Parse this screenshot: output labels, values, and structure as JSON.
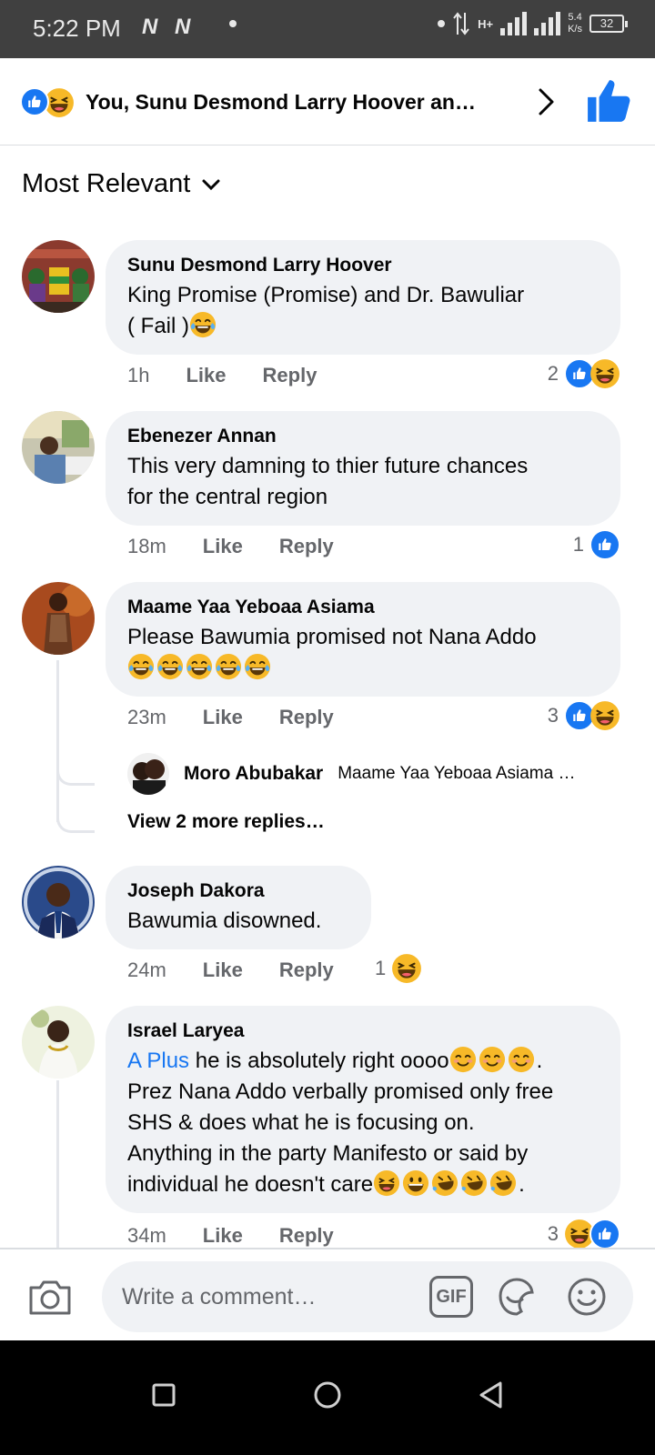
{
  "status_bar": {
    "time": "5:22 PM",
    "network_icons": "N N",
    "net_type": "H+",
    "speed_value": "5.4",
    "speed_unit": "K/s",
    "battery": "32"
  },
  "header": {
    "title": "You, Sunu Desmond Larry Hoover an…",
    "icons": [
      "like-reaction-icon",
      "haha-reaction-icon",
      "chevron-right-icon",
      "thumbs-up-icon"
    ]
  },
  "sort": {
    "label": "Most Relevant"
  },
  "comments": [
    {
      "author": "Sunu Desmond Larry Hoover",
      "text_line1": "King Promise (Promise) and Dr. Bawuliar",
      "text_line2": "( Fail )",
      "time": "1h",
      "like": "Like",
      "reply": "Reply",
      "reaction_count": "2"
    },
    {
      "author": "Ebenezer Annan",
      "text_line1": "This very damning to thier future chances",
      "text_line2": "for the central region",
      "time": "18m",
      "like": "Like",
      "reply": "Reply",
      "reaction_count": "1"
    },
    {
      "author": "Maame Yaa Yeboaa Asiama",
      "text_line1": "Please Bawumia promised not Nana Addo",
      "time": "23m",
      "like": "Like",
      "reply": "Reply",
      "reaction_count": "3"
    },
    {
      "author": "Joseph Dakora",
      "text_line1": "Bawumia disowned.",
      "time": "24m",
      "like": "Like",
      "reply": "Reply",
      "reaction_count": "1"
    },
    {
      "author": "Israel Laryea",
      "mention": "A Plus",
      "text_line1": " he is absolutely right oooo",
      "text_line2": "Prez Nana Addo verbally promised only free",
      "text_line3": "SHS & does what he is focusing on.",
      "text_line4": "Anything in the party Manifesto or said by",
      "text_line5": "individual he doesn't care",
      "time": "34m",
      "like": "Like",
      "reply": "Reply",
      "reaction_count": "3"
    }
  ],
  "reply_preview": {
    "author": "Moro Abubakar",
    "snippet": "Maame Yaa Yeboaa Asiama …",
    "view_more": "View 2 more replies…"
  },
  "composer": {
    "placeholder": "Write a comment…",
    "gif_label": "GIF"
  },
  "colors": {
    "accent": "#1877f2",
    "haha": "#f7b928",
    "bubble": "#f0f2f5",
    "meta_text": "#65676b"
  }
}
